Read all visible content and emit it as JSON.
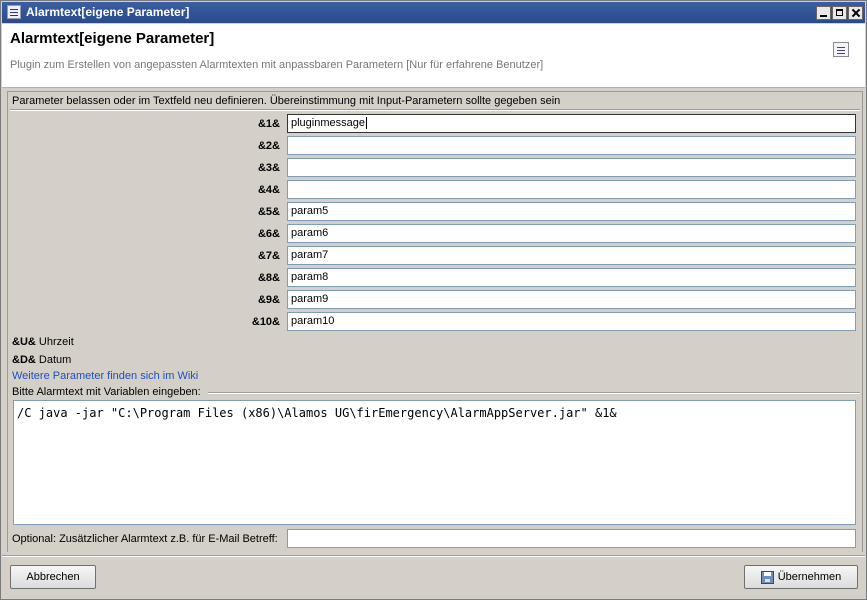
{
  "window": {
    "title": "Alarmtext[eigene Parameter]"
  },
  "header": {
    "title": "Alarmtext[eigene Parameter]",
    "subtitle": "Plugin zum Erstellen von angepassten Alarmtexten mit anpassbaren Parametern [Nur für erfahrene Benutzer]",
    "icon": "info-document-icon"
  },
  "intro": "Parameter belassen oder im Textfeld neu definieren. Übereinstimmung mit Input-Parametern sollte gegeben sein",
  "parameters": [
    {
      "label": "&1&",
      "value": "pluginmessage"
    },
    {
      "label": "&2&",
      "value": ""
    },
    {
      "label": "&3&",
      "value": ""
    },
    {
      "label": "&4&",
      "value": ""
    },
    {
      "label": "&5&",
      "value": "param5"
    },
    {
      "label": "&6&",
      "value": "param6"
    },
    {
      "label": "&7&",
      "value": "param7"
    },
    {
      "label": "&8&",
      "value": "param8"
    },
    {
      "label": "&9&",
      "value": "param9"
    },
    {
      "label": "&10&",
      "value": "param10"
    }
  ],
  "variables": [
    {
      "key": "&U&",
      "desc": "Uhrzeit"
    },
    {
      "key": "&D&",
      "desc": "Datum"
    }
  ],
  "wiki_link": "Weitere Parameter finden sich im Wiki",
  "alarmtext": {
    "label": "Bitte Alarmtext mit Variablen eingeben:",
    "value": "/C java -jar \"C:\\Program Files (x86)\\Alamos UG\\firEmergency\\AlarmAppServer.jar\" &1&"
  },
  "optional": {
    "label": "Optional: Zusätzlicher Alarmtext z.B. für E-Mail Betreff:",
    "value": ""
  },
  "buttons": {
    "cancel": "Abbrechen",
    "apply": "Übernehmen"
  },
  "colors": {
    "titlebar": "#2a4a8a",
    "link": "#1c4fc8",
    "background": "#d4d0c8"
  }
}
